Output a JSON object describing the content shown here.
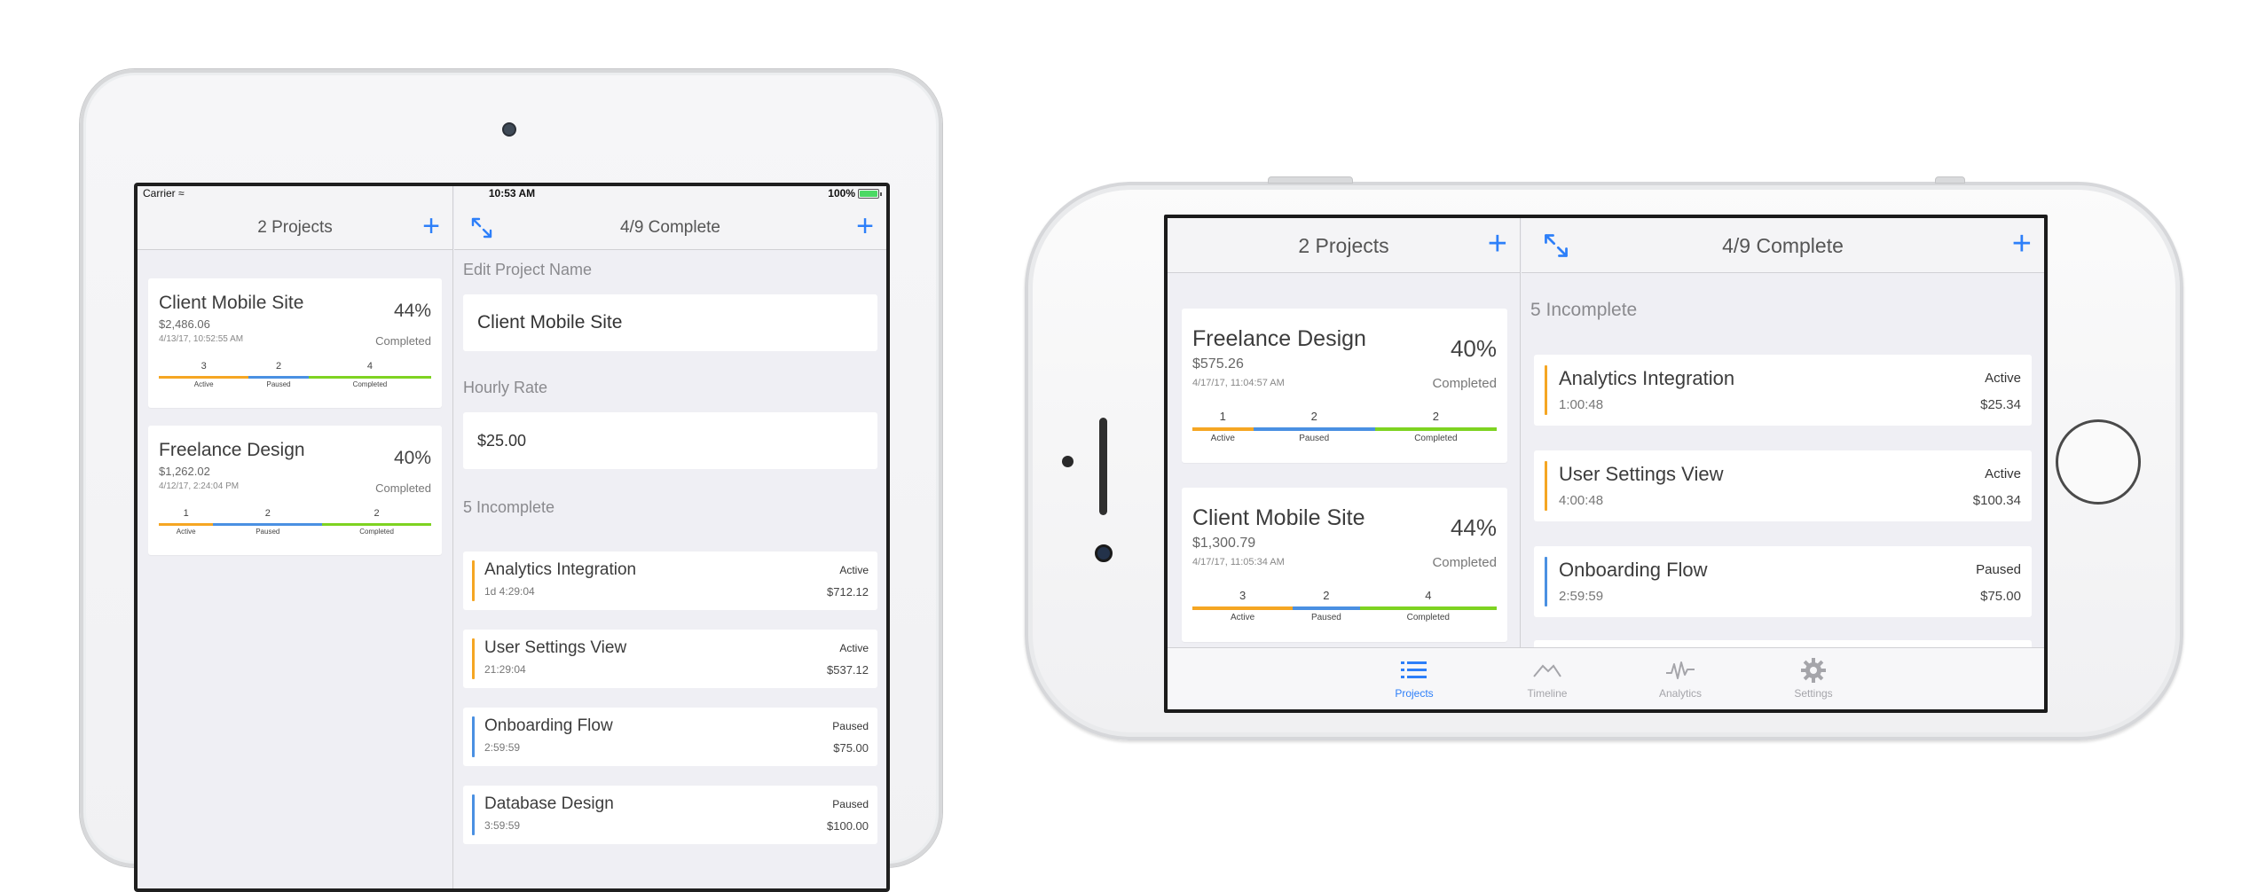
{
  "ipad": {
    "status": {
      "carrier": "Carrier",
      "time": "10:53 AM",
      "battery": "100%"
    },
    "left_nav": {
      "title": "2 Projects"
    },
    "right_nav": {
      "title": "4/9 Complete"
    },
    "projects": [
      {
        "name": "Client Mobile Site",
        "amount": "$2,486.06",
        "date": "4/13/17, 10:52:55 AM",
        "percent": "44%",
        "completed_label": "Completed",
        "counts": [
          {
            "num": "3",
            "label": "Active"
          },
          {
            "num": "2",
            "label": "Paused"
          },
          {
            "num": "4",
            "label": "Completed"
          }
        ]
      },
      {
        "name": "Freelance Design",
        "amount": "$1,262.02",
        "date": "4/12/17, 2:24:04 PM",
        "percent": "40%",
        "completed_label": "Completed",
        "counts": [
          {
            "num": "1",
            "label": "Active"
          },
          {
            "num": "2",
            "label": "Paused"
          },
          {
            "num": "2",
            "label": "Completed"
          }
        ]
      }
    ],
    "edit_name_label": "Edit Project Name",
    "project_name_value": "Client Mobile Site",
    "hourly_rate_label": "Hourly Rate",
    "hourly_rate_value": "$25.00",
    "incomplete_label": "5 Incomplete",
    "tasks": [
      {
        "name": "Analytics Integration",
        "time": "1d 4:29:04",
        "status": "Active",
        "amount": "$712.12",
        "color": "#f5a623"
      },
      {
        "name": "User Settings View",
        "time": "21:29:04",
        "status": "Active",
        "amount": "$537.12",
        "color": "#f5a623"
      },
      {
        "name": "Onboarding Flow",
        "time": "2:59:59",
        "status": "Paused",
        "amount": "$75.00",
        "color": "#4a90e2"
      },
      {
        "name": "Database Design",
        "time": "3:59:59",
        "status": "Paused",
        "amount": "$100.00",
        "color": "#4a90e2"
      }
    ]
  },
  "iphone": {
    "left_nav": {
      "title": "2 Projects"
    },
    "right_nav": {
      "title": "4/9 Complete"
    },
    "projects": [
      {
        "name": "Freelance Design",
        "amount": "$575.26",
        "date": "4/17/17, 11:04:57 AM",
        "percent": "40%",
        "completed_label": "Completed",
        "counts": [
          {
            "num": "1",
            "label": "Active"
          },
          {
            "num": "2",
            "label": "Paused"
          },
          {
            "num": "2",
            "label": "Completed"
          }
        ]
      },
      {
        "name": "Client Mobile Site",
        "amount": "$1,300.79",
        "date": "4/17/17, 11:05:34 AM",
        "percent": "44%",
        "completed_label": "Completed",
        "counts": [
          {
            "num": "3",
            "label": "Active"
          },
          {
            "num": "2",
            "label": "Paused"
          },
          {
            "num": "4",
            "label": "Completed"
          }
        ]
      }
    ],
    "incomplete_label": "5 Incomplete",
    "tasks": [
      {
        "name": "Analytics Integration",
        "time": "1:00:48",
        "status": "Active",
        "amount": "$25.34",
        "color": "#f5a623"
      },
      {
        "name": "User Settings View",
        "time": "4:00:48",
        "status": "Active",
        "amount": "$100.34",
        "color": "#f5a623"
      },
      {
        "name": "Onboarding Flow",
        "time": "2:59:59",
        "status": "Paused",
        "amount": "$75.00",
        "color": "#4a90e2"
      }
    ],
    "tabs": [
      {
        "label": "Projects",
        "icon": "list-icon",
        "active": true
      },
      {
        "label": "Timeline",
        "icon": "timeline-icon",
        "active": false
      },
      {
        "label": "Analytics",
        "icon": "analytics-icon",
        "active": false
      },
      {
        "label": "Settings",
        "icon": "gear-icon",
        "active": false
      }
    ]
  },
  "colors": {
    "accent": "#2d7ff9",
    "active": "#f5a623",
    "paused": "#4a90e2",
    "completed": "#7ed321"
  }
}
